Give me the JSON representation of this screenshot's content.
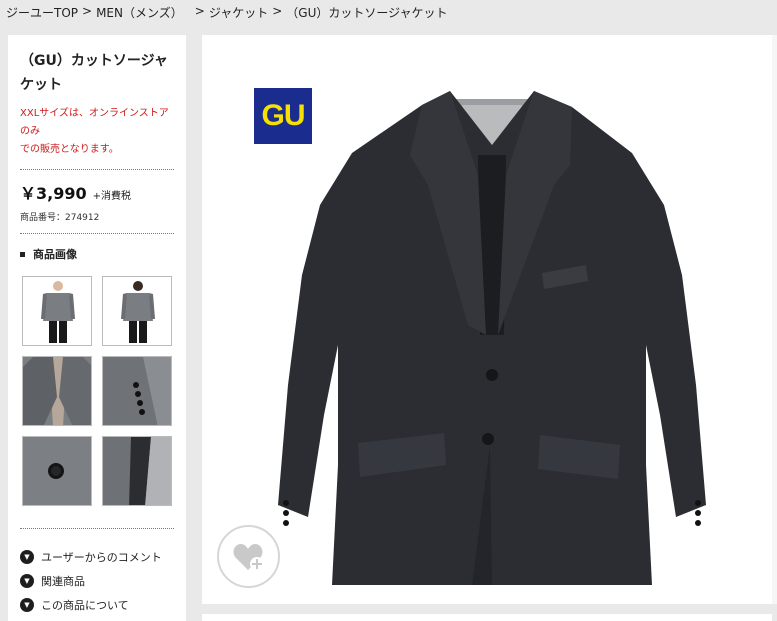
{
  "breadcrumb": {
    "items": [
      "ジーユーTOP",
      "MEN（メンズ）",
      "ジャケット",
      "（GU）カットソージャケット"
    ],
    "separator": ">"
  },
  "product": {
    "title_line1": "（GU）カットソージャ",
    "title_line2": "ケット",
    "notice_line1": "XXLサイズは、オンラインストアのみ",
    "notice_line2": "での販売となります。",
    "price": "￥3,990",
    "tax": "+消費税",
    "item_number": "商品番号：274912"
  },
  "images_section": {
    "heading": "商品画像",
    "thumbnails": [
      "front-full",
      "back-full",
      "detail-collar",
      "detail-cuff",
      "detail-button",
      "detail-lining"
    ]
  },
  "links": [
    {
      "label": "ユーザーからのコメント",
      "icon": "chevron-down-icon"
    },
    {
      "label": "関連商品",
      "icon": "chevron-down-icon"
    },
    {
      "label": "この商品について",
      "icon": "chevron-down-icon"
    }
  ],
  "logo": {
    "text": "GU",
    "bg": "#1b2c8f",
    "fg": "#f5e000"
  },
  "colors": {
    "jacket": "#2b2d33",
    "notice": "#cc1a1a"
  }
}
